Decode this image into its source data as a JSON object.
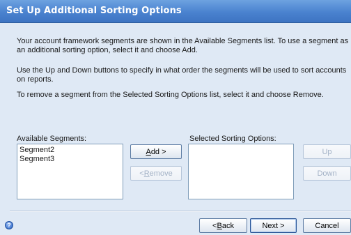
{
  "window": {
    "title": "Set Up Additional Sorting Options"
  },
  "intro": {
    "p1": "Your account framework segments are shown in the Available Segments list. To use a segment as an additional sorting option, select it and choose Add.",
    "p2": "Use the Up and Down buttons to specify in what order the segments will be used to sort accounts on reports.",
    "p3": "To remove a segment from the Selected Sorting Options list, select it and choose Remove."
  },
  "available": {
    "label": "Available Segments:",
    "items": [
      "Segment2",
      "Segment3"
    ]
  },
  "selected": {
    "label": "Selected Sorting Options:",
    "items": []
  },
  "buttons": {
    "add_mnemonic": "A",
    "add_rest": "dd >",
    "remove_prefix": "< ",
    "remove_mnemonic": "R",
    "remove_rest": "emove",
    "up": "Up",
    "down": "Down",
    "back_prefix": "< ",
    "back_mnemonic": "B",
    "back_rest": "ack",
    "next": "Next >",
    "cancel": "Cancel"
  },
  "footer": {
    "help_icon": "help-icon",
    "help_glyph": "?"
  },
  "colors": {
    "titlebar": "#4a82cf",
    "background": "#dfe9f5",
    "disabled_text": "#a3b2c6"
  }
}
